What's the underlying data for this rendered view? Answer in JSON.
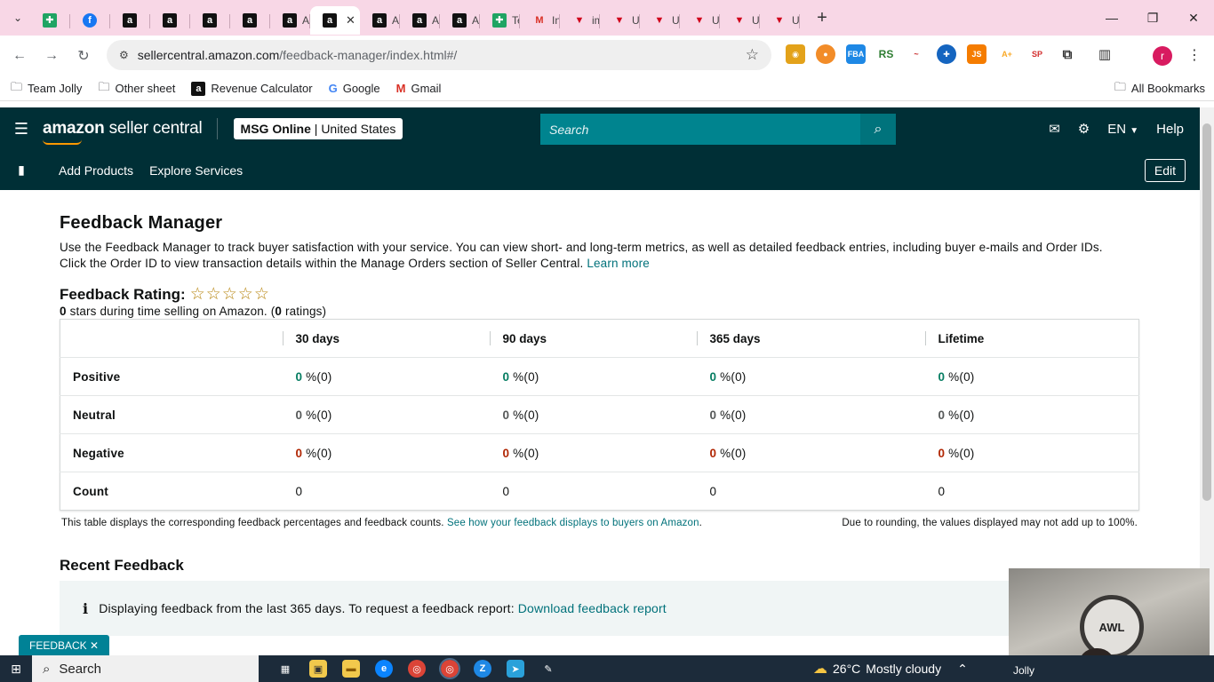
{
  "browser": {
    "tabs": [
      {
        "icon": "sheets-icon",
        "label": ""
      },
      {
        "icon": "facebook-icon",
        "label": ""
      },
      {
        "icon": "amazon-icon",
        "label": ""
      },
      {
        "icon": "amazon-icon",
        "label": ""
      },
      {
        "icon": "amazon-icon",
        "label": ""
      },
      {
        "icon": "amazon-icon",
        "label": ""
      },
      {
        "icon": "amazon-icon",
        "label": "Am"
      },
      {
        "icon": "amazon-icon",
        "label": ""
      },
      {
        "icon": "amazon-icon",
        "label": "Am"
      },
      {
        "icon": "amazon-icon",
        "label": "Am"
      },
      {
        "icon": "amazon-icon",
        "label": "Am"
      },
      {
        "icon": "sheets-icon",
        "label": "Tea"
      },
      {
        "icon": "gmail-icon",
        "label": "Inb"
      },
      {
        "icon": "triangle-icon",
        "label": "ima"
      },
      {
        "icon": "triangle-icon",
        "label": "Upl"
      },
      {
        "icon": "triangle-icon",
        "label": "Upl"
      },
      {
        "icon": "triangle-icon",
        "label": "Upl"
      },
      {
        "icon": "triangle-icon",
        "label": "Upl"
      },
      {
        "icon": "triangle-icon",
        "label": "Up"
      }
    ],
    "url_host": "sellercentral.amazon.com",
    "url_path": "/feedback-manager/index.html#/",
    "bookmarks": [
      "Team Jolly",
      "Other sheet",
      "Revenue Calculator",
      "Google",
      "Gmail"
    ],
    "bookmarks_right": "All Bookmarks",
    "profile_initial": "r"
  },
  "header": {
    "logo_bold": "amazon",
    "logo_rest": " seller central",
    "store_name": "MSG Online",
    "store_region": "United States",
    "search_placeholder": "Search",
    "language": "EN",
    "help": "Help"
  },
  "subnav": {
    "links": [
      "Add Products",
      "Explore Services"
    ],
    "edit": "Edit"
  },
  "page": {
    "title": "Feedback Manager",
    "description": "Use the Feedback Manager to track buyer satisfaction with your service. You can view short- and long-term metrics, as well as detailed feedback entries, including buyer e-mails and Order IDs. Click the Order ID to view transaction details within the Manage Orders section of Seller Central.",
    "learn_more": "Learn more",
    "rating_label": "Feedback Rating:",
    "rating_stars": "☆☆☆☆☆",
    "rating_sub_stars": "0",
    "rating_sub_text1": " stars during time selling on Amazon. (",
    "rating_sub_count": "0",
    "rating_sub_text2": " ratings)"
  },
  "table": {
    "columns": [
      "30 days",
      "90 days",
      "365 days",
      "Lifetime"
    ],
    "rows": [
      {
        "label": "Positive",
        "cells": [
          {
            "v": "0",
            "s": " %(0)"
          },
          {
            "v": "0",
            "s": " %(0)"
          },
          {
            "v": "0",
            "s": " %(0)"
          },
          {
            "v": "0",
            "s": " %(0)"
          }
        ]
      },
      {
        "label": "Neutral",
        "cells": [
          {
            "v": "0",
            "s": " %(0)"
          },
          {
            "v": "0",
            "s": " %(0)"
          },
          {
            "v": "0",
            "s": " %(0)"
          },
          {
            "v": "0",
            "s": " %(0)"
          }
        ]
      },
      {
        "label": "Negative",
        "cells": [
          {
            "v": "0",
            "s": " %(0)"
          },
          {
            "v": "0",
            "s": " %(0)"
          },
          {
            "v": "0",
            "s": " %(0)"
          },
          {
            "v": "0",
            "s": " %(0)"
          }
        ]
      },
      {
        "label": "Count",
        "cells": [
          {
            "v": "0"
          },
          {
            "v": "0"
          },
          {
            "v": "0"
          },
          {
            "v": "0"
          }
        ]
      }
    ],
    "footnote_left": "This table displays the corresponding feedback percentages and feedback counts.",
    "footnote_link": "See how your feedback displays to buyers on Amazon",
    "footnote_right": "Due to rounding, the values displayed may not add up to 100%."
  },
  "recent": {
    "title": "Recent Feedback",
    "info_text": "Displaying feedback from the last 365 days. To request a feedback report:",
    "info_link": "Download feedback report"
  },
  "feedback_chip": "FEEDBACK ✕",
  "taskbar": {
    "search": "Search",
    "temperature": "26°C",
    "weather": "Mostly cloudy",
    "user_tag": "Jolly"
  },
  "colors": {
    "header_bg": "#002f36",
    "search_bg": "#00848f",
    "positive": "#067d62",
    "negative": "#b12704",
    "tab_strip": "#f8d7e6"
  }
}
